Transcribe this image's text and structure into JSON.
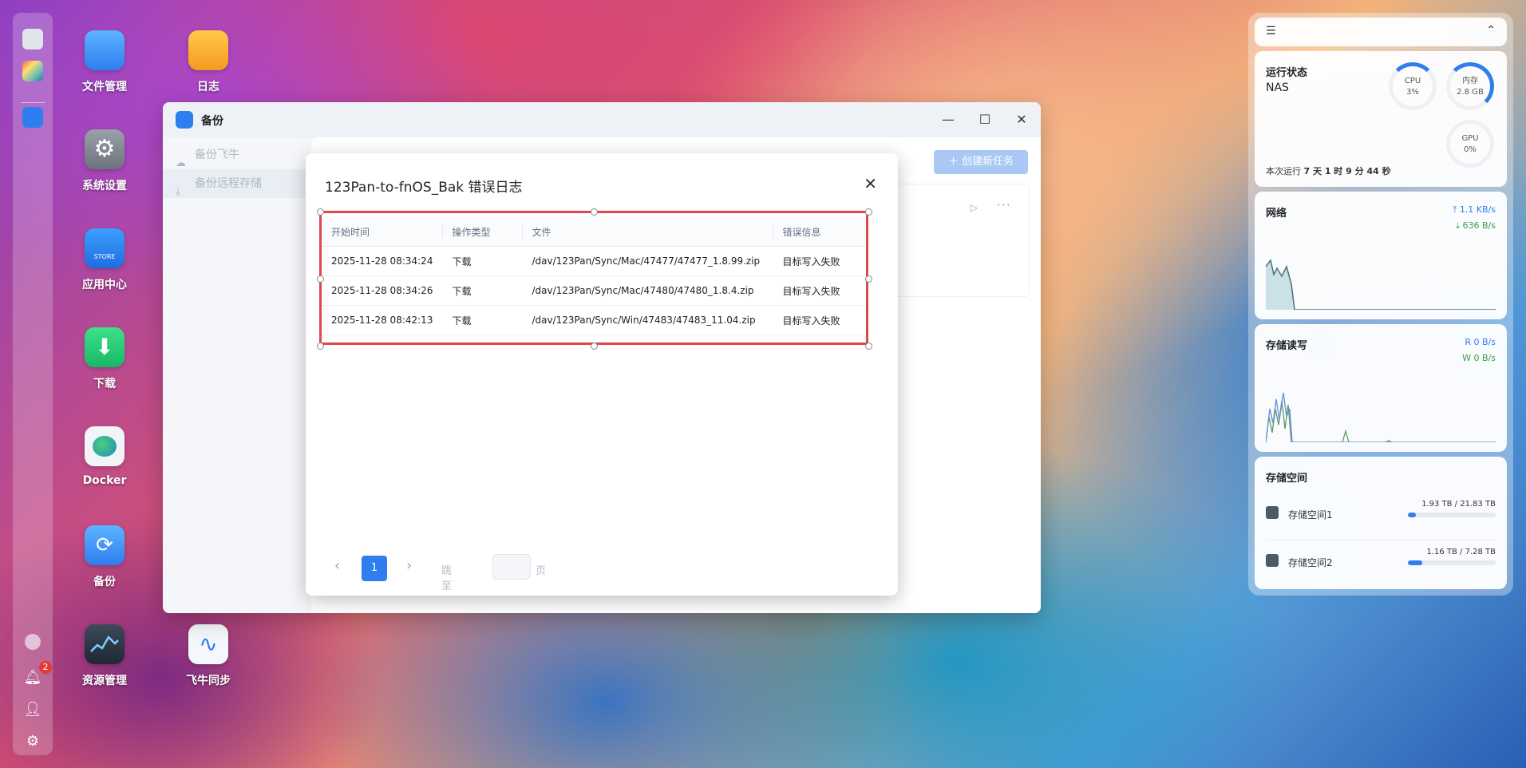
{
  "desktop": {
    "icons": [
      {
        "label": "文件管理"
      },
      {
        "label": "日志"
      },
      {
        "label": "系统设置"
      },
      {
        "label": "应用中心",
        "tile_text": "STORE"
      },
      {
        "label": "下载"
      },
      {
        "label": "Docker"
      },
      {
        "label": "备份"
      },
      {
        "label": "资源管理"
      },
      {
        "label": "飞牛同步"
      }
    ]
  },
  "dock": {
    "notification_count": "2"
  },
  "window": {
    "title": "备份",
    "sidebar": [
      {
        "label": "备份飞牛"
      },
      {
        "label": "备份远程存储"
      }
    ],
    "create_button": "创建新任务"
  },
  "dialog": {
    "title": "123Pan-to-fnOS_Bak 错误日志",
    "columns": [
      "开始时间",
      "操作类型",
      "文件",
      "错误信息"
    ],
    "rows": [
      {
        "time": "2025-11-28 08:34:24",
        "op": "下载",
        "file": "/dav/123Pan/Sync/Mac/47477/47477_1.8.99.zip",
        "error": "目标写入失败"
      },
      {
        "time": "2025-11-28 08:34:26",
        "op": "下载",
        "file": "/dav/123Pan/Sync/Mac/47480/47480_1.8.4.zip",
        "error": "目标写入失败"
      },
      {
        "time": "2025-11-28 08:42:13",
        "op": "下载",
        "file": "/dav/123Pan/Sync/Win/47483/47483_11.04.zip",
        "error": "目标写入失败"
      }
    ],
    "pagination": {
      "current_page": "1",
      "jump_label": "跳至",
      "page_suffix": "页",
      "jump_value": ""
    }
  },
  "widgets": {
    "status": {
      "title": "运行状态",
      "device": "NAS",
      "cpu_label": "CPU",
      "cpu_value": "3%",
      "cpu_fraction": 0.03,
      "mem_label": "内存",
      "mem_value": "2.8 GB",
      "mem_fraction": 0.38,
      "gpu_label": "GPU",
      "gpu_value": "0%",
      "gpu_fraction": 0,
      "uptime_label": "本次运行",
      "uptime_value": "7 天 1 时 9 分 44 秒"
    },
    "network": {
      "title": "网络",
      "up": "1.1 KB/s",
      "down": "636 B/s"
    },
    "disk_io": {
      "title": "存储读写",
      "read_label": "R",
      "read_value": "0 B/s",
      "write_label": "W",
      "write_value": "0 B/s"
    },
    "storage": {
      "title": "存储空间",
      "volumes": [
        {
          "name": "存储空间1",
          "used": "1.93 TB",
          "total": "21.83 TB",
          "fraction": 0.088
        },
        {
          "name": "存储空间2",
          "used": "1.16 TB",
          "total": "7.28 TB",
          "fraction": 0.16
        }
      ]
    }
  },
  "colors": {
    "accent": "#2f7ef0",
    "highlight": "#e0474c",
    "green": "#3a9a45"
  }
}
